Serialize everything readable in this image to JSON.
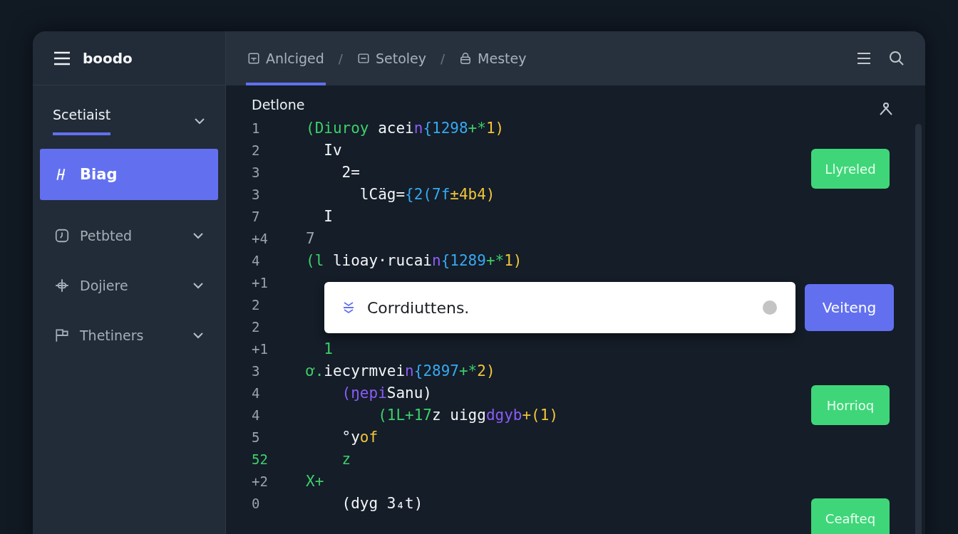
{
  "sidebar": {
    "brand": "boodo",
    "section": {
      "label": "Scetiaist",
      "expanded": true
    },
    "items": [
      {
        "label": "Biag",
        "selected": true
      },
      {
        "label": "Petbted",
        "selected": false,
        "expanded": false
      },
      {
        "label": "Dojiere",
        "selected": false,
        "expanded": false
      },
      {
        "label": "Thetiners",
        "selected": false,
        "expanded": false
      }
    ]
  },
  "tabs": [
    {
      "label": "Anlciged",
      "selected": true
    },
    {
      "separator": "/",
      "label": "Setoley",
      "selected": false
    },
    {
      "separator": "/",
      "label": "Mestey",
      "selected": false
    }
  ],
  "editor": {
    "title": "Detlone",
    "lines": [
      {
        "number": "1",
        "kind": "normal",
        "segments": [
          {
            "text": "(Diuroy",
            "color": "#3ecf6a"
          },
          {
            "text": " acei",
            "color": "#f2f4f6"
          },
          {
            "text": "n",
            "color": "#8b5cf6"
          },
          {
            "text": "{1298",
            "color": "#38a8f0"
          },
          {
            "text": "+*",
            "color": "#3ecf6a"
          },
          {
            "text": "1)",
            "color": "#f0c43a"
          }
        ]
      },
      {
        "number": "2",
        "kind": "normal",
        "segments": [
          {
            "text": "  Iv",
            "color": "#f2f4f6"
          }
        ]
      },
      {
        "number": "3",
        "kind": "normal",
        "segments": [
          {
            "text": "    2=",
            "color": "#f2f4f6"
          }
        ]
      },
      {
        "number": "3",
        "kind": "normal",
        "segments": [
          {
            "text": "      lCäg=",
            "color": "#f2f4f6"
          },
          {
            "text": "{2(7f",
            "color": "#38a8f0"
          },
          {
            "text": "±4b4)",
            "color": "#f0c43a"
          }
        ]
      },
      {
        "number": "7",
        "kind": "normal",
        "segments": [
          {
            "text": "  I",
            "color": "#f2f4f6"
          }
        ]
      },
      {
        "number": "+4",
        "kind": "normal",
        "segments": [
          {
            "text": "7",
            "color": "#9aa3ad"
          }
        ]
      },
      {
        "number": "4",
        "kind": "normal",
        "segments": [
          {
            "text": "(l",
            "color": "#3ecf6a"
          },
          {
            "text": " lioay·rucai",
            "color": "#f2f4f6"
          },
          {
            "text": "n",
            "color": "#8b5cf6"
          },
          {
            "text": "{1289",
            "color": "#38a8f0"
          },
          {
            "text": "+*",
            "color": "#3ecf6a"
          },
          {
            "text": "1)",
            "color": "#f0c43a"
          }
        ]
      },
      {
        "number": "+1",
        "kind": "normal"
      },
      {
        "number": "2",
        "kind": "normal"
      },
      {
        "number": "2",
        "kind": "normal"
      },
      {
        "number": "+1",
        "kind": "normal",
        "segments": [
          {
            "text": "  1",
            "color": "#3ecf6a"
          }
        ]
      },
      {
        "number": "3",
        "kind": "normal",
        "segments": [
          {
            "text": "ơ.",
            "color": "#3ecf6a"
          },
          {
            "text": "iecyrmvei",
            "color": "#f2f4f6"
          },
          {
            "text": "n",
            "color": "#8b5cf6"
          },
          {
            "text": "{2897",
            "color": "#38a8f0"
          },
          {
            "text": "+*",
            "color": "#3ecf6a"
          },
          {
            "text": "2)",
            "color": "#f0c43a"
          }
        ]
      },
      {
        "number": "4",
        "kind": "normal",
        "segments": [
          {
            "text": "    (ŋepi",
            "color": "#8b5cf6"
          },
          {
            "text": "Sanu)",
            "color": "#f2f4f6"
          }
        ]
      },
      {
        "number": "4",
        "kind": "normal",
        "segments": [
          {
            "text": "        (1L+17",
            "color": "#3ecf6a"
          },
          {
            "text": "z uigg",
            "color": "#f2f4f6"
          },
          {
            "text": "dgyb",
            "color": "#8b5cf6"
          },
          {
            "text": "+(1)",
            "color": "#f0c43a"
          }
        ]
      },
      {
        "number": "5",
        "kind": "normal",
        "segments": [
          {
            "text": "    °y",
            "color": "#f2f4f6"
          },
          {
            "text": "of",
            "color": "#f0c43a"
          }
        ]
      },
      {
        "number": "52",
        "kind": "added",
        "segments": [
          {
            "text": "    z",
            "color": "#3ecf6a"
          }
        ]
      },
      {
        "number": "+2",
        "kind": "normal",
        "segments": [
          {
            "text": "X+",
            "color": "#3ecf6a"
          }
        ]
      },
      {
        "number": "0",
        "kind": "normal",
        "segments": [
          {
            "text": "    (dyg 3₄t)",
            "color": "#f2f4f6"
          }
        ]
      }
    ],
    "actions": [
      "Llyreled",
      "Horrioq",
      "Ceafteq"
    ],
    "prompt": {
      "value": "Corrdiuttens.",
      "button": "Veiteng"
    }
  }
}
